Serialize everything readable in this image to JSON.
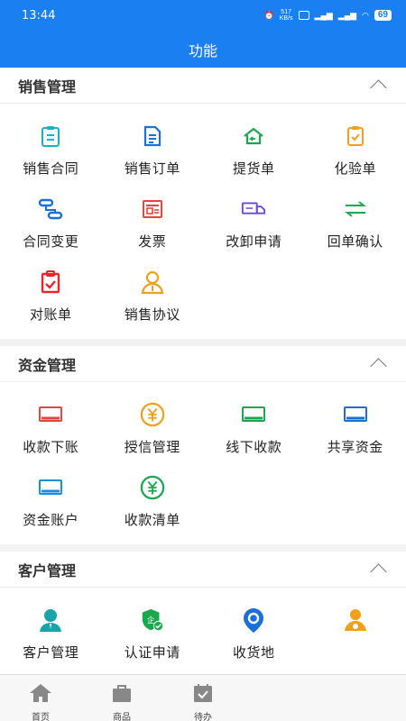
{
  "status": {
    "time": "13:44",
    "speed": "517\nKB/s",
    "battery": "69"
  },
  "header": {
    "title": "功能"
  },
  "sections": [
    {
      "title": "销售管理",
      "items": [
        {
          "label": "销售合同",
          "icon": "clipboard-icon",
          "color": "#17b1c4"
        },
        {
          "label": "销售订单",
          "icon": "document-icon",
          "color": "#1a6fd9"
        },
        {
          "label": "提货单",
          "icon": "house-return-icon",
          "color": "#1aa84f"
        },
        {
          "label": "化验单",
          "icon": "checklist-icon",
          "color": "#f0a01a"
        },
        {
          "label": "合同变更",
          "icon": "flow-icon",
          "color": "#1a6fd9"
        },
        {
          "label": "发票",
          "icon": "invoice-icon",
          "color": "#e8443a"
        },
        {
          "label": "改卸申请",
          "icon": "truck-icon",
          "color": "#6a4bd6"
        },
        {
          "label": "回单确认",
          "icon": "exchange-icon",
          "color": "#1aa84f"
        },
        {
          "label": "对账单",
          "icon": "reconcile-icon",
          "color": "#e8262a"
        },
        {
          "label": "销售协议",
          "icon": "person-icon",
          "color": "#f0a01a"
        }
      ]
    },
    {
      "title": "资金管理",
      "items": [
        {
          "label": "收款下账",
          "icon": "card-icon",
          "color": "#e8443a"
        },
        {
          "label": "授信管理",
          "icon": "yuan-circle-icon",
          "color": "#f0a01a"
        },
        {
          "label": "线下收款",
          "icon": "card-icon",
          "color": "#1aa84f"
        },
        {
          "label": "共享资金",
          "icon": "card-icon",
          "color": "#1a6fd9"
        },
        {
          "label": "资金账户",
          "icon": "card-icon",
          "color": "#1a8fd9"
        },
        {
          "label": "收款清单",
          "icon": "yuan-circle-icon",
          "color": "#1aa84f"
        }
      ]
    },
    {
      "title": "客户管理",
      "items": [
        {
          "label": "客户管理",
          "icon": "customer-icon",
          "color": "#17a5a9"
        },
        {
          "label": "认证申请",
          "icon": "certify-icon",
          "color": "#1aa84f"
        },
        {
          "label": "收货地",
          "icon": "location-icon",
          "color": "#1a6fd9"
        },
        {
          "label": "",
          "icon": "driver-icon",
          "color": "#f0a01a"
        }
      ]
    }
  ],
  "tabs": [
    {
      "label": "首页",
      "icon": "home-icon"
    },
    {
      "label": "商品",
      "icon": "bag-icon"
    },
    {
      "label": "待办",
      "icon": "calendar-check-icon"
    }
  ]
}
